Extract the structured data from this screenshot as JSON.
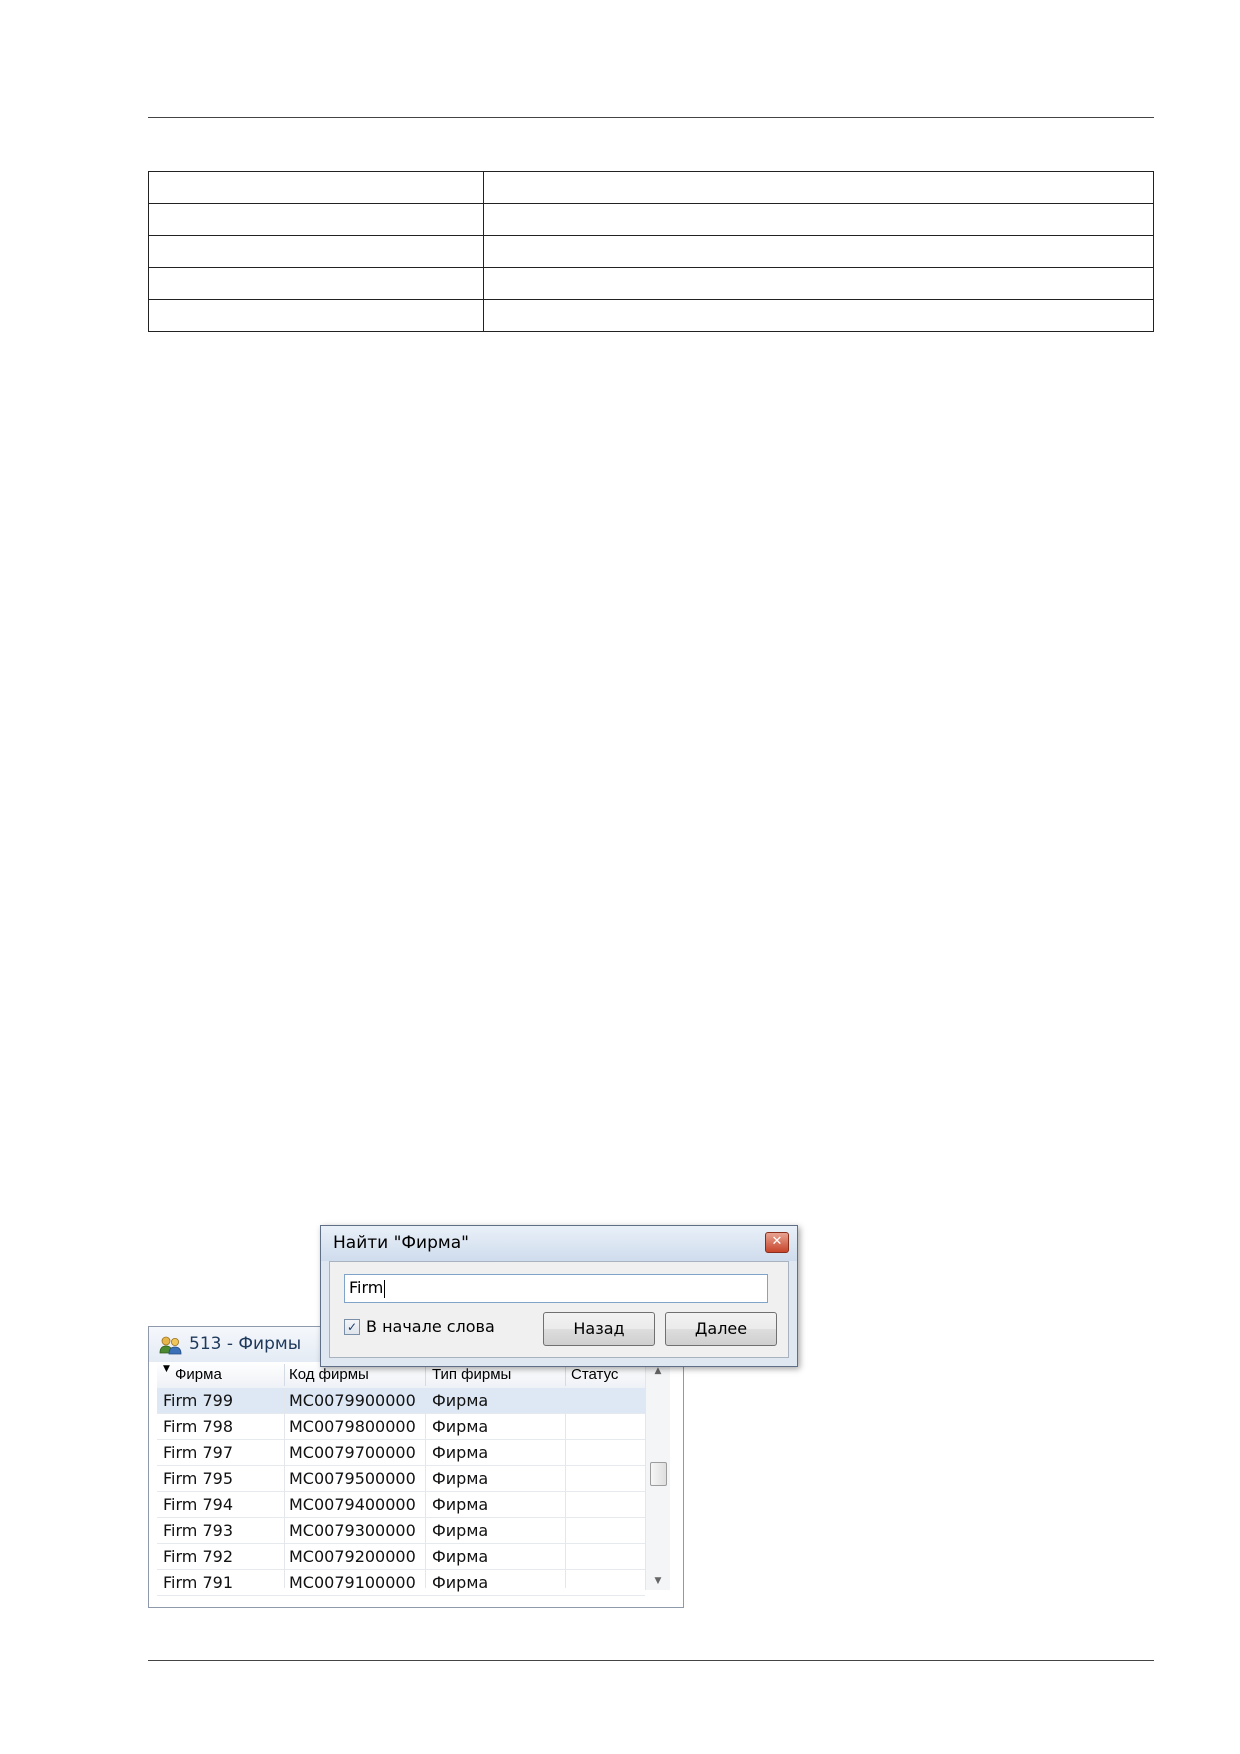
{
  "find_dialog": {
    "title": "Найти \"Фирма\"",
    "close_glyph": "✕",
    "search_value": "Firm",
    "checkbox_label": "В начале слова",
    "checkbox_checked": true,
    "back_button": "Назад",
    "next_button": "Далее"
  },
  "firm_window": {
    "title": "513 - Фирмы",
    "icon": "users-group-icon",
    "columns": [
      "Фирма",
      "Код фирмы",
      "Тип фирмы",
      "Статус"
    ],
    "rows": [
      {
        "firm": "Firm 799",
        "code": "MC0079900000",
        "type": "Фирма",
        "status": ""
      },
      {
        "firm": "Firm 798",
        "code": "MC0079800000",
        "type": "Фирма",
        "status": ""
      },
      {
        "firm": "Firm 797",
        "code": "MC0079700000",
        "type": "Фирма",
        "status": ""
      },
      {
        "firm": "Firm 795",
        "code": "MC0079500000",
        "type": "Фирма",
        "status": ""
      },
      {
        "firm": "Firm 794",
        "code": "MC0079400000",
        "type": "Фирма",
        "status": ""
      },
      {
        "firm": "Firm 793",
        "code": "MC0079300000",
        "type": "Фирма",
        "status": ""
      },
      {
        "firm": "Firm 792",
        "code": "MC0079200000",
        "type": "Фирма",
        "status": ""
      },
      {
        "firm": "Firm 791",
        "code": "MC0079100000",
        "type": "Фирма",
        "status": ""
      }
    ]
  }
}
